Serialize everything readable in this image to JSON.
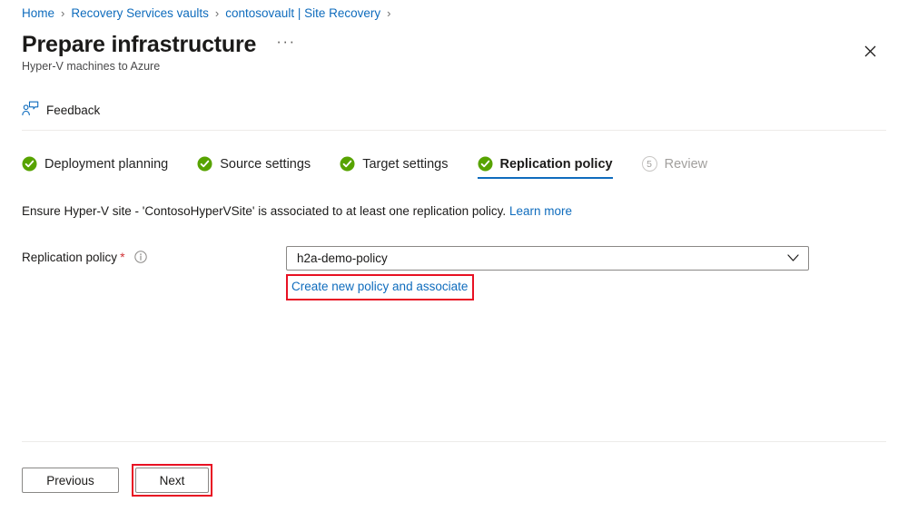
{
  "breadcrumb": {
    "separator": "›",
    "items": [
      {
        "label": "Home"
      },
      {
        "label": "Recovery Services vaults"
      },
      {
        "label": "contosovault | Site Recovery"
      }
    ]
  },
  "header": {
    "title": "Prepare infrastructure",
    "subtitle": "Hyper-V machines to Azure",
    "more_label": "···",
    "close_label": "Close"
  },
  "commandbar": {
    "feedback_label": "Feedback",
    "feedback_icon": "feedback-person-icon"
  },
  "tabs": [
    {
      "label": "Deployment planning",
      "state": "complete",
      "icon": "check-circle-icon"
    },
    {
      "label": "Source settings",
      "state": "complete",
      "icon": "check-circle-icon"
    },
    {
      "label": "Target settings",
      "state": "complete",
      "icon": "check-circle-icon"
    },
    {
      "label": "Replication policy",
      "state": "active",
      "icon": "check-circle-icon"
    },
    {
      "label": "Review",
      "state": "upcoming",
      "step": "5"
    }
  ],
  "content": {
    "description_text": "Ensure Hyper-V site - 'ContosoHyperVSite' is associated to at least one replication policy.",
    "description_link": "Learn more",
    "field": {
      "label": "Replication policy",
      "required_marker": "*",
      "info_icon": "info-circle-icon",
      "selected_value": "h2a-demo-policy",
      "dropdown_icon": "chevron-down-icon",
      "create_link": "Create new policy and associate"
    }
  },
  "footer": {
    "previous_label": "Previous",
    "next_label": "Next"
  },
  "colors": {
    "link": "#0f6cbd",
    "accent_underline": "#0f6cbd",
    "success_green": "#57a300",
    "highlight_red": "#e81123",
    "required_red": "#d13438",
    "disabled_gray": "#a19f9d"
  }
}
